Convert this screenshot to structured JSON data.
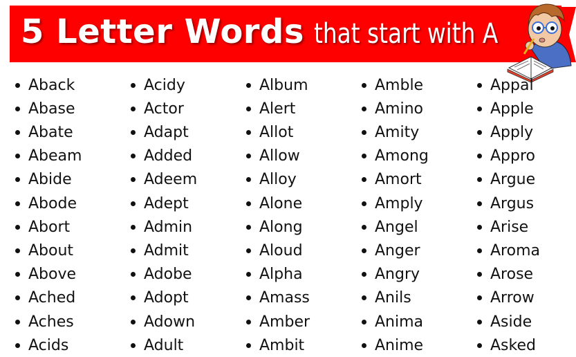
{
  "banner": {
    "title_bold": "5 Letter Words",
    "title_light": "that start with A",
    "background_color": "#fe0000",
    "mascot": "thinking-student-reading-book-illustration"
  },
  "word_columns": [
    [
      "Aback",
      "Abase",
      "Abate",
      "Abeam",
      "Abide",
      "Abode",
      "Abort",
      "About",
      "Above",
      "Ached",
      "Aches",
      "Acids"
    ],
    [
      "Acidy",
      "Actor",
      "Adapt",
      "Added",
      "Adeem",
      "Adept",
      "Admin",
      "Admit",
      "Adobe",
      "Adopt",
      "Adown",
      "Adult"
    ],
    [
      "Album",
      "Alert",
      "Allot",
      "Allow",
      "Alloy",
      "Alone",
      "Along",
      "Aloud",
      "Alpha",
      "Amass",
      "Amber",
      "Ambit"
    ],
    [
      "Amble",
      "Amino",
      "Amity",
      "Among",
      "Amort",
      "Amply",
      "Angel",
      "Anger",
      "Angry",
      "Anils",
      "Anima",
      "Anime"
    ],
    [
      "Appal",
      "Apple",
      "Apply",
      "Appro",
      "Argue",
      "Argus",
      "Arise",
      "Aroma",
      "Arose",
      "Arrow",
      "Aside",
      "Asked"
    ]
  ]
}
